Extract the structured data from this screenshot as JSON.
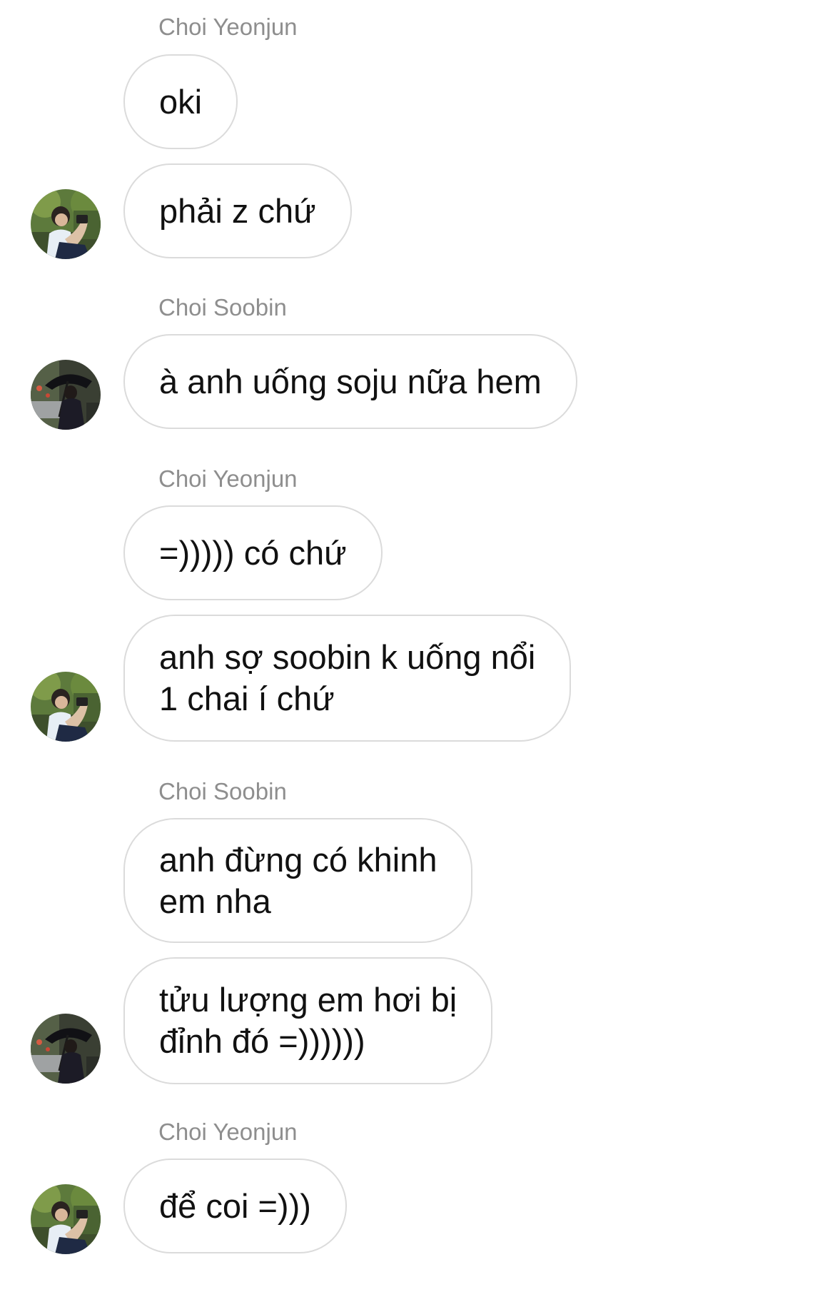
{
  "conversation": {
    "m1": {
      "sender": "Choi Yeonjun",
      "text": "oki"
    },
    "m2": {
      "text": "phải z chứ"
    },
    "m3": {
      "sender": "Choi Soobin",
      "text": "à anh uống soju nữa hem"
    },
    "m4": {
      "sender": "Choi Yeonjun",
      "text": "=))))) có chứ"
    },
    "m5": {
      "line1": "anh sợ soobin k uống nổi",
      "line2": "1 chai í chứ"
    },
    "m6": {
      "sender": "Choi Soobin",
      "line1": "anh đừng có khinh",
      "line2": "em nha"
    },
    "m7": {
      "line1": "tửu lượng em hơi bị",
      "line2": "đỉnh đó =))))))"
    },
    "m8": {
      "sender": "Choi Yeonjun",
      "text": "để coi =)))"
    }
  },
  "colors": {
    "bubble_border": "#dbdbdb",
    "sender_name": "#8e8e8e",
    "text": "#111111"
  },
  "icons": {
    "avatar_yeonjun": "profile-photo",
    "avatar_soobin": "profile-photo"
  }
}
